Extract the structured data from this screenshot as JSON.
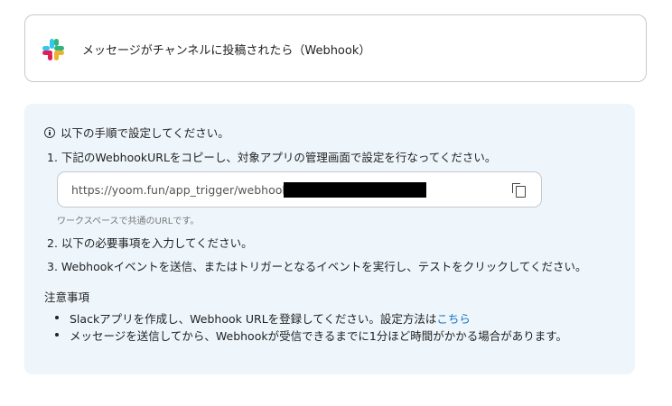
{
  "trigger": {
    "title": "メッセージがチャンネルに投稿されたら（Webhook）",
    "app_icon": "slack-logo"
  },
  "instructions": {
    "heading": "以下の手順で設定してください。",
    "heading_icon": "info-icon",
    "step1": "1. 下記のWebhookURLをコピーし、対象アプリの管理画面で設定を行なってください。",
    "webhook_url": "https://yoom.fun/app_trigger/webhooks",
    "copy_icon": "copy-icon",
    "url_hint": "ワークスペースで共通のURLです。",
    "step2": "2. 以下の必要事項を入力してください。",
    "step3": "3. Webhookイベントを送信、またはトリガーとなるイベントを実行し、テストをクリックしてください。"
  },
  "notes": {
    "title": "注意事項",
    "item1_text": "Slackアプリを作成し、Webhook URLを登録してください。設定方法は",
    "item1_link": "こちら",
    "item2_text": "メッセージを送信してから、Webhookが受信できるまでに1分ほど時間がかかる場合があります。"
  },
  "colors": {
    "panel_bg": "#eef6fc",
    "link": "#1a73c7",
    "slack_blue": "#36C5F0",
    "slack_green": "#2EB67D",
    "slack_red": "#E01E5A",
    "slack_yellow": "#ECB22E"
  }
}
